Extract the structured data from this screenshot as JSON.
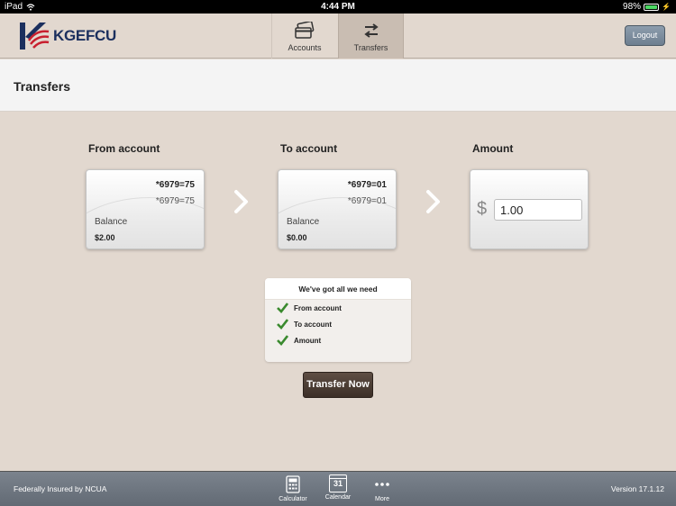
{
  "status": {
    "device": "iPad",
    "time": "4:44 PM",
    "battery": "98%",
    "battery_level": 0.98
  },
  "header": {
    "logo_text": "KGEFCU",
    "tabs": [
      {
        "label": "Accounts",
        "icon": "cards-icon",
        "active": false
      },
      {
        "label": "Transfers",
        "icon": "transfer-arrows-icon",
        "active": true
      }
    ],
    "logout_label": "Logout"
  },
  "page": {
    "title": "Transfers"
  },
  "from": {
    "label": "From account",
    "account_main": "*6979=75",
    "account_sub": "*6979=75",
    "balance_label": "Balance",
    "balance_value": "$2.00"
  },
  "to": {
    "label": "To account",
    "account_main": "*6979=01",
    "account_sub": "*6979=01",
    "balance_label": "Balance",
    "balance_value": "$0.00"
  },
  "amount": {
    "label": "Amount",
    "currency": "$",
    "value": "1.00"
  },
  "checklist": {
    "title": "We've got all we need",
    "items": [
      "From account",
      "To account",
      "Amount"
    ]
  },
  "transfer_button": "Transfer Now",
  "footer": {
    "insured": "Federally Insured by NCUA",
    "items": [
      {
        "label": "Calculator",
        "icon": "calculator-icon"
      },
      {
        "label": "Calendar",
        "icon": "calendar-icon",
        "day": "31"
      },
      {
        "label": "More",
        "icon": "more-dots-icon"
      }
    ],
    "version": "Version 17.1.12"
  },
  "colors": {
    "background": "#e2d8cf",
    "button_dark": "#3c2f27",
    "check_green": "#3a8a2e",
    "footer": "#6b737d"
  }
}
